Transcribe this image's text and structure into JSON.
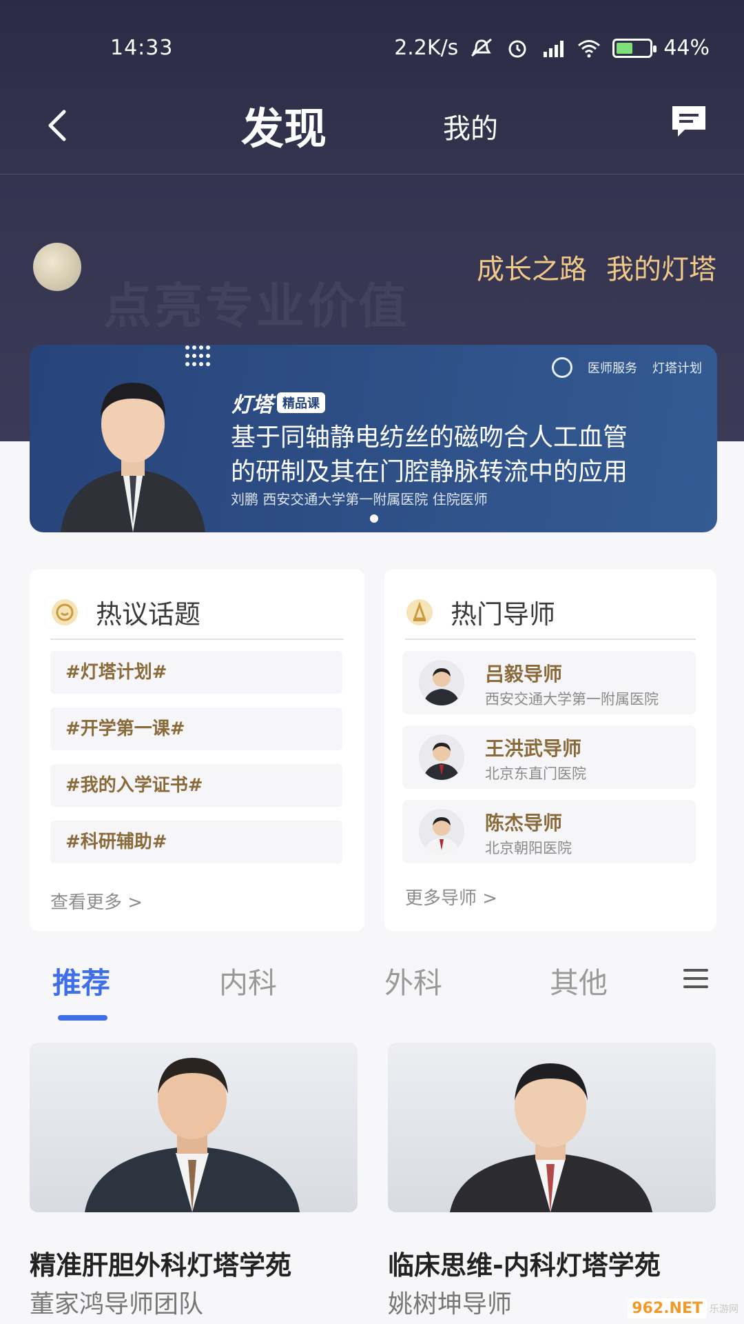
{
  "status_bar": {
    "time": "14:33",
    "network_speed": "2.2K/s",
    "battery": "44%",
    "battery_level": 0.44,
    "icons": [
      "mute-icon",
      "alarm-icon",
      "hd-signal-icon",
      "wifi-icon",
      "battery-charging-icon"
    ]
  },
  "nav": {
    "title": "发现",
    "mine": "我的"
  },
  "hero": {
    "watermark": "点亮专业价值",
    "growth_path": "成长之路",
    "my_lighthouse": "我的灯塔"
  },
  "banner": {
    "logo_doctor_service": "医师服务",
    "logo_lighthouse_plan": "灯塔计划",
    "brand": "灯塔",
    "brand_tag": "精品课",
    "title_line1": "基于同轴静电纺丝的磁吻合人工血管",
    "title_line2": "的研制及其在门腔静脉转流中的应用",
    "speaker": "刘鹏  西安交通大学第一附属医院 住院医师"
  },
  "hot_topics": {
    "title": "热议话题",
    "items": [
      "#灯塔计划#",
      "#开学第一课#",
      "#我的入学证书#",
      "#科研辅助#"
    ],
    "more": "查看更多 >"
  },
  "hot_mentors": {
    "title": "热门导师",
    "items": [
      {
        "name": "吕毅导师",
        "hospital": "西安交通大学第一附属医院"
      },
      {
        "name": "王洪武导师",
        "hospital": "北京东直门医院"
      },
      {
        "name": "陈杰导师",
        "hospital": "北京朝阳医院"
      }
    ],
    "more": "更多导师 >"
  },
  "tabs": {
    "items": [
      "推荐",
      "内科",
      "外科",
      "其他"
    ],
    "active_index": 0
  },
  "courses": [
    {
      "title": "精准肝胆外科灯塔学苑",
      "team": "董家鸿导师团队"
    },
    {
      "title": "临床思维-内科灯塔学苑",
      "team": "姚树坤导师"
    }
  ],
  "site_watermark": {
    "number": "962.NET",
    "name": "乐游网"
  },
  "colors": {
    "header_bg": "#2b2b45",
    "gold_accent": "#f0c989",
    "tab_active": "#3f6fe6",
    "banner_bg": "#2d4f86",
    "topic_text": "#8a6a3a"
  }
}
